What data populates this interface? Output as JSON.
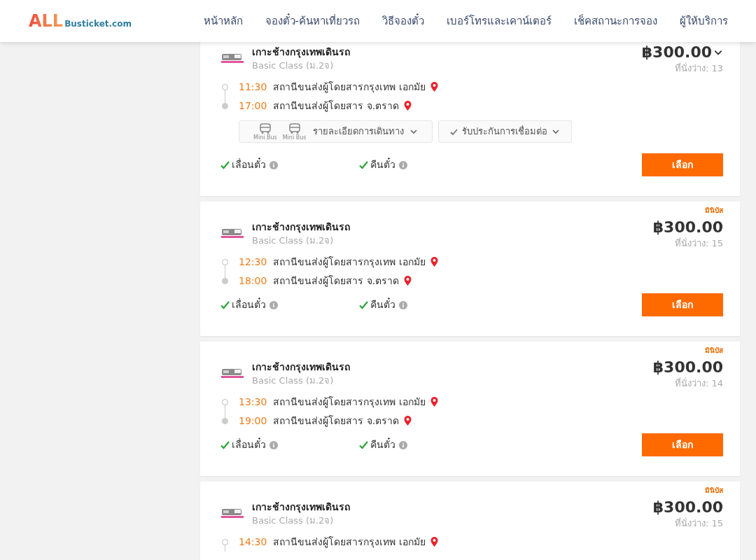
{
  "header": {
    "logo": {
      "main": "ALL",
      "sub": "Busticket.com"
    },
    "nav": [
      {
        "label": "หน้าหลัก"
      },
      {
        "label": "จองตั๋ว-ค้นหาเที่ยวรถ"
      },
      {
        "label": "วิธีจองตั๋ว"
      },
      {
        "label": "เบอร์โทรและเคาน์เตอร์"
      },
      {
        "label": "เช็คสถานะการจอง"
      },
      {
        "label": "ผู้ให้บริการ"
      }
    ]
  },
  "trips": [
    {
      "operator": "เกาะช้างกรุงเทพเดินรถ",
      "class": "Basic Class (ม.2จ)",
      "price": "฿300.00",
      "expanded": true,
      "seats": "ที่นั่งว่าง: 13",
      "stops": [
        {
          "time": "11:30",
          "station": "สถานีขนส่งผู้โดยสารกรุงเทพ เอกมัย"
        },
        {
          "time": "17:00",
          "station": "สถานีขนส่งผู้โดยสาร จ.ตราด"
        }
      ],
      "details": {
        "vehicles": [
          "Mini Bus",
          "Mini Bus"
        ],
        "label": "รายละเอียดการเดินทาง",
        "insurance": "รับประกันการเชื่อมต่อ"
      },
      "features": [
        {
          "label": "เลื่อนตั๋ว",
          "available": true
        },
        {
          "label": "คืนตั๋ว",
          "available": true
        }
      ],
      "button": "เลือก"
    },
    {
      "badge": "มินิบัส",
      "operator": "เกาะช้างกรุงเทพเดินรถ",
      "class": "Basic Class (ม.2จ)",
      "price": "฿300.00",
      "expanded": false,
      "seats": "ที่นั่งว่าง: 15",
      "stops": [
        {
          "time": "12:30",
          "station": "สถานีขนส่งผู้โดยสารกรุงเทพ เอกมัย"
        },
        {
          "time": "18:00",
          "station": "สถานีขนส่งผู้โดยสาร จ.ตราด"
        }
      ],
      "features": [
        {
          "label": "เลื่อนตั๋ว",
          "available": true
        },
        {
          "label": "คืนตั๋ว",
          "available": true
        }
      ],
      "button": "เลือก"
    },
    {
      "badge": "มินิบัส",
      "operator": "เกาะช้างกรุงเทพเดินรถ",
      "class": "Basic Class (ม.2จ)",
      "price": "฿300.00",
      "expanded": false,
      "seats": "ที่นั่งว่าง: 14",
      "stops": [
        {
          "time": "13:30",
          "station": "สถานีขนส่งผู้โดยสารกรุงเทพ เอกมัย"
        },
        {
          "time": "19:00",
          "station": "สถานีขนส่งผู้โดยสาร จ.ตราด"
        }
      ],
      "features": [
        {
          "label": "เลื่อนตั๋ว",
          "available": true
        },
        {
          "label": "คืนตั๋ว",
          "available": true
        }
      ],
      "button": "เลือก"
    },
    {
      "badge": "มินิบัส",
      "operator": "เกาะช้างกรุงเทพเดินรถ",
      "class": "Basic Class (ม.2จ)",
      "price": "฿300.00",
      "expanded": false,
      "seats": "ที่นั่งว่าง: 15",
      "stops": [
        {
          "time": "14:30",
          "station": "สถานีขนส่งผู้โดยสารกรุงเทพ เอกมัย"
        }
      ]
    }
  ]
}
